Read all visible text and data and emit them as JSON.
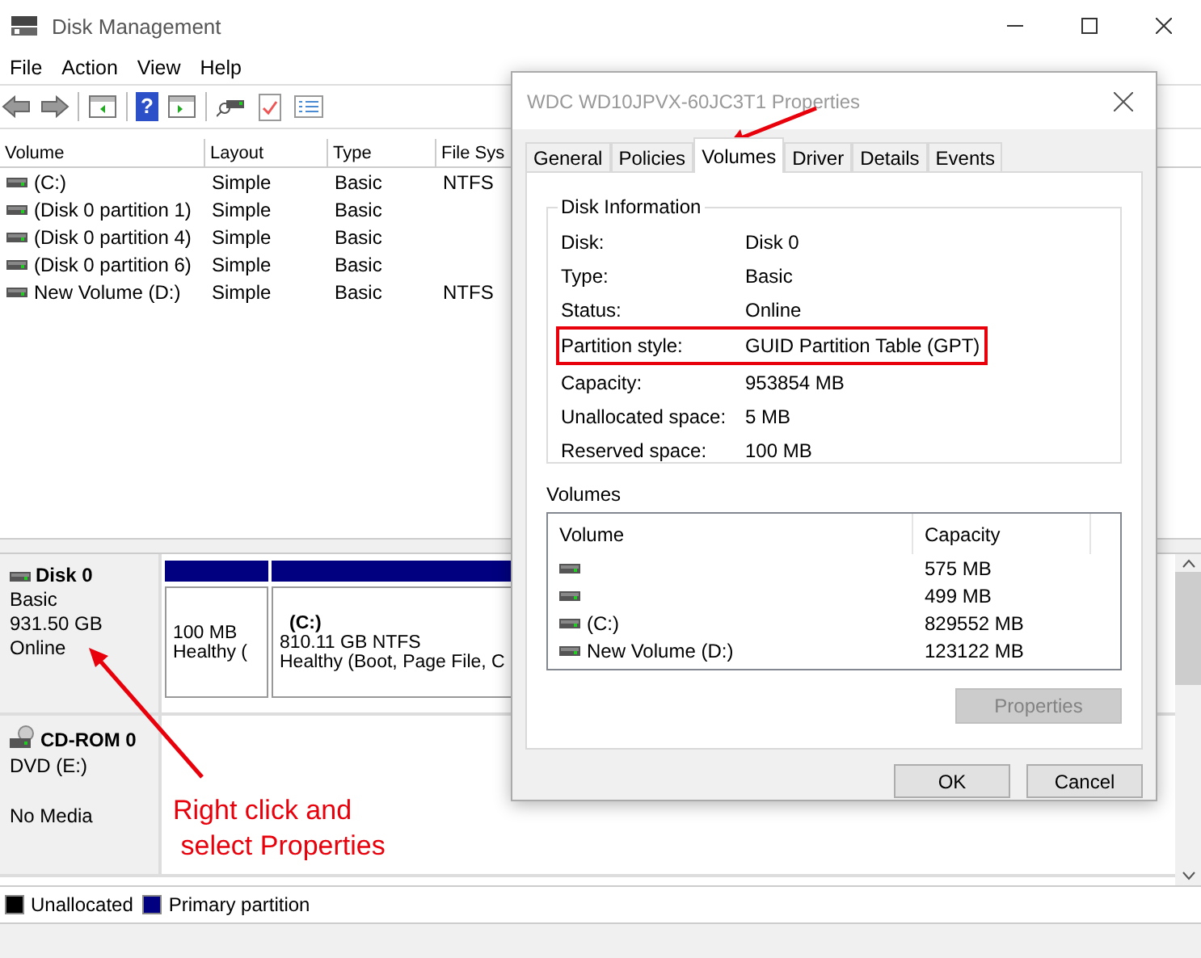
{
  "window": {
    "title": "Disk Management"
  },
  "menu": [
    "File",
    "Action",
    "View",
    "Help"
  ],
  "toolbar": {
    "help_glyph": "?"
  },
  "volume_list": {
    "columns": [
      "Volume",
      "Layout",
      "Type",
      "File Sys"
    ],
    "rows": [
      [
        "(C:)",
        "Simple",
        "Basic",
        "NTFS"
      ],
      [
        "(Disk 0 partition 1)",
        "Simple",
        "Basic"
      ],
      [
        "(Disk 0 partition 4)",
        "Simple",
        "Basic"
      ],
      [
        "(Disk 0 partition 6)",
        "Simple",
        "Basic"
      ],
      [
        "New Volume (D:)",
        "Simple",
        "Basic",
        "NTFS"
      ]
    ]
  },
  "disks": [
    {
      "kind": "disk",
      "name": "Disk 0",
      "type": "Basic",
      "size": "931.50 GB",
      "status": "Online",
      "partitions": [
        {
          "lines": [
            "100 MB",
            "Healthy ("
          ]
        },
        {
          "title": "(C:)",
          "lines": [
            "810.11 GB NTFS",
            "Healthy (Boot, Page File, C"
          ]
        }
      ]
    },
    {
      "kind": "cdrom",
      "name": "CD-ROM 0",
      "type": "DVD (E:)",
      "status": "No Media"
    }
  ],
  "legend": [
    {
      "label": "Unallocated",
      "color": "#000000"
    },
    {
      "label": "Primary partition",
      "color": "#000080"
    }
  ],
  "dialog": {
    "title": "WDC WD10JPVX-60JC3T1 Properties",
    "tabs": [
      {
        "label": "General",
        "selected": false
      },
      {
        "label": "Policies",
        "selected": false
      },
      {
        "label": "Volumes",
        "selected": true
      },
      {
        "label": "Driver",
        "selected": false
      },
      {
        "label": "Details",
        "selected": false
      },
      {
        "label": "Events",
        "selected": false
      }
    ],
    "disk_information": {
      "title": "Disk Information",
      "rows": [
        {
          "label": "Disk:",
          "value": "Disk 0",
          "highlighted": false
        },
        {
          "label": "Type:",
          "value": "Basic",
          "highlighted": false
        },
        {
          "label": "Status:",
          "value": "Online",
          "highlighted": false
        },
        {
          "label": "Partition style:",
          "value": "GUID Partition Table (GPT)",
          "highlighted": true
        },
        {
          "label": "Capacity:",
          "value": "953854 MB",
          "highlighted": false
        },
        {
          "label": "Unallocated space:",
          "value": "5 MB",
          "highlighted": false
        },
        {
          "label": "Reserved space:",
          "value": "100 MB",
          "highlighted": false
        }
      ]
    },
    "volumes": {
      "title": "Volumes",
      "columns": [
        "Volume",
        "Capacity"
      ],
      "rows": [
        {
          "capacity": "575 MB"
        },
        {
          "capacity": "499 MB"
        },
        {
          "volume": "(C:)",
          "capacity": "829552 MB"
        },
        {
          "volume": "New Volume (D:)",
          "capacity": "123122 MB"
        }
      ]
    },
    "properties_button": {
      "label": "Properties",
      "disabled": true
    },
    "buttons": [
      "OK",
      "Cancel"
    ]
  },
  "annotation": {
    "lines": [
      "Right click and",
      "select Properties"
    ]
  }
}
